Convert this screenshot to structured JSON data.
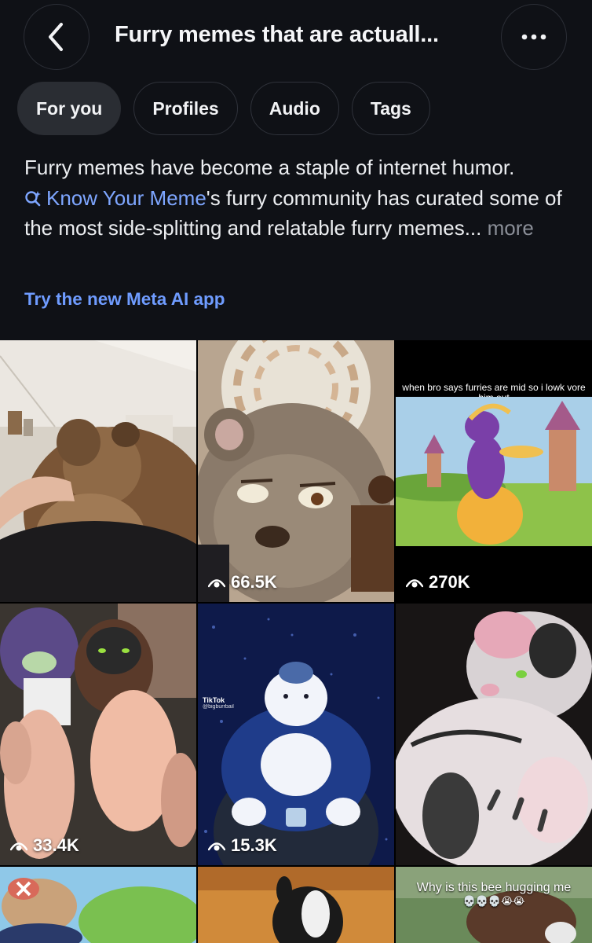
{
  "header": {
    "title": "Furry memes that are actuall...",
    "back_icon": "chevron-left-icon",
    "more_icon": "ellipsis-icon"
  },
  "tabs": [
    {
      "label": "For you",
      "active": true
    },
    {
      "label": "Profiles",
      "active": false
    },
    {
      "label": "Audio",
      "active": false
    },
    {
      "label": "Tags",
      "active": false
    }
  ],
  "description": {
    "line1": "Furry memes have become a staple of internet humor.",
    "link_icon": "search-sparkle-icon",
    "link_text": "Know Your Meme",
    "after_link": "'s furry community has curated some of the most side-splitting and relatable furry memes...",
    "more": "more"
  },
  "meta_link": "Try the new Meta AI app",
  "grid": {
    "tiles": [
      {
        "views": ""
      },
      {
        "views": "66.5K"
      },
      {
        "views": "270K",
        "caption": "when bro says furries are mid so i lowk vore him out"
      },
      {
        "views": "33.4K"
      },
      {
        "views": "15.3K",
        "tiktok_label": "TikTok",
        "tiktok_handle": "@bigburrbail"
      },
      {
        "views": ""
      },
      {
        "views": ""
      },
      {
        "views": ""
      },
      {
        "views": "",
        "caption": "Why is this bee hugging me",
        "emoji_row": "💀💀💀😭😭"
      }
    ]
  },
  "colors": {
    "background": "#0f1116",
    "link_blue": "#6f9cff",
    "tab_active": "#2a2d33"
  }
}
